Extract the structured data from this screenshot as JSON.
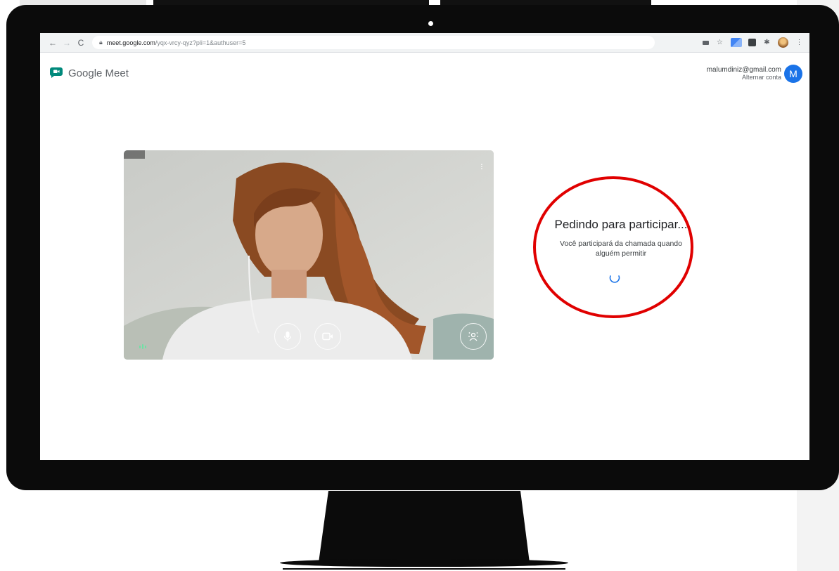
{
  "browser": {
    "url_host": "meet.google.com",
    "url_path": "/yqx-vrcy-qyz?pli=1&authuser=5",
    "nav": {
      "back": "←",
      "forward": "→",
      "reload": "C"
    }
  },
  "app": {
    "name": "Google Meet"
  },
  "account": {
    "email": "malumdiniz@gmail.com",
    "switch_label": "Alternar conta",
    "avatar_initial": "M"
  },
  "join_status": {
    "title": "Pedindo para participar...",
    "message": "Você participará da chamada quando alguém permitir"
  },
  "colors": {
    "meet_green": "#00897b",
    "accent_blue": "#1a73e8",
    "highlight_red": "#e00000",
    "monitor": "#0b0b0b"
  },
  "icons": {
    "mic": "microphone-icon",
    "camera": "video-camera-icon",
    "effects": "visual-effects-icon",
    "more": "more-vert-icon",
    "spinner": "loading-spinner-icon"
  }
}
